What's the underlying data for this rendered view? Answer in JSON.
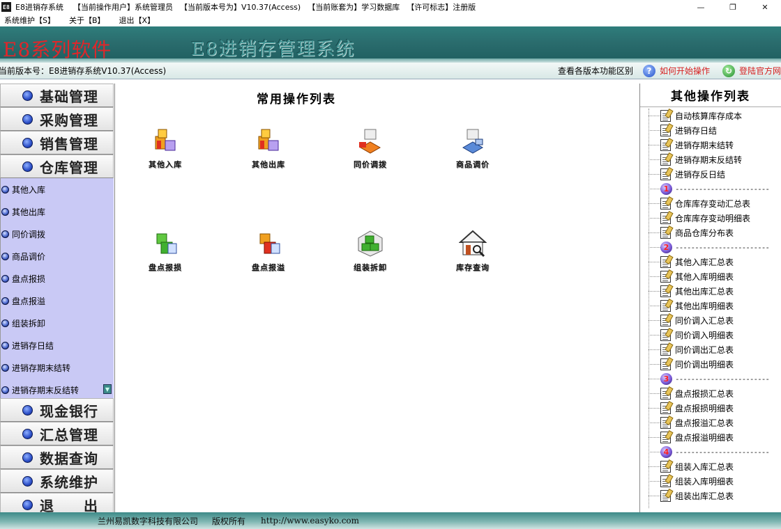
{
  "titlebar": {
    "icon_text": "E8",
    "app_name": "E8进销存系统",
    "user_label": "【当前操作用户】",
    "user": "系统管理员",
    "version_label": "【当前版本号为】",
    "version": "V10.37(Access)",
    "account_label": "【当前账套为】",
    "account": "学习数据库",
    "license_label": "【许可标志】",
    "license": "注册版",
    "min": "—",
    "restore": "❐",
    "close": "✕"
  },
  "menu": [
    "系统维护【S】",
    "关于【B】",
    "退出【X】"
  ],
  "banner": {
    "brand": "E8系列软件",
    "system_name": "E8进销存管理系统"
  },
  "status": {
    "version_text": "当前版本号：E8进销存系统V10.37(Access)",
    "compare": "查看各版本功能区别",
    "help": "如何开始操作",
    "site": "登陆官方网站"
  },
  "left_nav": {
    "top": [
      "基础管理",
      "采购管理",
      "销售管理",
      "仓库管理"
    ],
    "sub_items": [
      "其他入库",
      "其他出库",
      "同价调拨",
      "商品调价",
      "盘点报损",
      "盘点报溢",
      "组装拆卸",
      "进销存日结",
      "进销存期末结转",
      "进销存期末反结转"
    ],
    "bottom": [
      "现金银行",
      "汇总管理",
      "数据查询",
      "系统维护",
      "退　　出"
    ]
  },
  "main": {
    "title": "常用操作列表",
    "tiles": [
      "其他入库",
      "其他出库",
      "同价调拨",
      "商品调价",
      "盘点报损",
      "盘点报溢",
      "组装拆卸",
      "库存查询"
    ]
  },
  "right": {
    "title": "其他操作列表",
    "rows": [
      {
        "t": "doc",
        "label": "自动核算库存成本"
      },
      {
        "t": "doc",
        "label": "进销存日结"
      },
      {
        "t": "doc",
        "label": "进销存期末结转"
      },
      {
        "t": "doc",
        "label": "进销存期末反结转"
      },
      {
        "t": "doc",
        "label": "进销存反日结"
      },
      {
        "t": "sep",
        "num": "1",
        "label": "------------------------"
      },
      {
        "t": "doc",
        "label": "仓库库存变动汇总表"
      },
      {
        "t": "doc",
        "label": "仓库库存变动明细表"
      },
      {
        "t": "doc",
        "label": "商品仓库分布表"
      },
      {
        "t": "sep",
        "num": "2",
        "label": "------------------------"
      },
      {
        "t": "doc",
        "label": "其他入库汇总表"
      },
      {
        "t": "doc",
        "label": "其他入库明细表"
      },
      {
        "t": "doc",
        "label": "其他出库汇总表"
      },
      {
        "t": "doc",
        "label": "其他出库明细表"
      },
      {
        "t": "doc",
        "label": "同价调入汇总表"
      },
      {
        "t": "doc",
        "label": "同价调入明细表"
      },
      {
        "t": "doc",
        "label": "同价调出汇总表"
      },
      {
        "t": "doc",
        "label": "同价调出明细表"
      },
      {
        "t": "sep",
        "num": "3",
        "label": "------------------------"
      },
      {
        "t": "doc",
        "label": "盘点报损汇总表"
      },
      {
        "t": "doc",
        "label": "盘点报损明细表"
      },
      {
        "t": "doc",
        "label": "盘点报溢汇总表"
      },
      {
        "t": "doc",
        "label": "盘点报溢明细表"
      },
      {
        "t": "sep",
        "num": "4",
        "label": "------------------------"
      },
      {
        "t": "doc",
        "label": "组装入库汇总表"
      },
      {
        "t": "doc",
        "label": "组装入库明细表"
      },
      {
        "t": "doc",
        "label": "组装出库汇总表"
      }
    ]
  },
  "footer": {
    "company": "兰州易凯数字科技有限公司",
    "rights": "版权所有",
    "url": "http://www.easyko.com"
  }
}
